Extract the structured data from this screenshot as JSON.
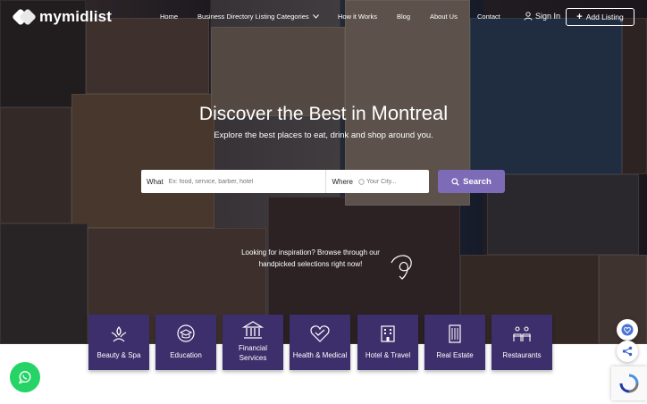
{
  "brand": {
    "name": "mymidlist"
  },
  "nav": {
    "items": [
      {
        "label": "Home"
      },
      {
        "label": "Business Directory Listing Categories"
      },
      {
        "label": "How it Works"
      },
      {
        "label": "Blog"
      },
      {
        "label": "About Us"
      },
      {
        "label": "Contact"
      }
    ],
    "signin": "Sign In",
    "add_listing": "Add Listing"
  },
  "hero": {
    "title_prefix": "Discover the Best in",
    "city": "Montreal",
    "subtitle": "Explore the best places to eat, drink and shop around you."
  },
  "search": {
    "what_label": "What",
    "what_placeholder": "Ex: food, service, barber, hotel",
    "where_label": "Where",
    "where_placeholder": "Your City...",
    "button": "Search"
  },
  "inspiration": {
    "line1": "Looking for inspiration? Browse through our",
    "line2": "handpicked selections right now!"
  },
  "categories": [
    {
      "label": "Beauty & Spa",
      "icon": "spa-icon"
    },
    {
      "label": "Education",
      "icon": "education-icon"
    },
    {
      "label": "Financial Services",
      "icon": "bank-icon"
    },
    {
      "label": "Health & Medical",
      "icon": "heart-icon"
    },
    {
      "label": "Hotel & Travel",
      "icon": "hotel-icon"
    },
    {
      "label": "Real Estate",
      "icon": "building-icon"
    },
    {
      "label": "Restaurants",
      "icon": "restaurant-icon"
    }
  ],
  "colors": {
    "accent": "#7d6bb7",
    "category_bg": "#3d2f6b",
    "whatsapp": "#25d366"
  }
}
